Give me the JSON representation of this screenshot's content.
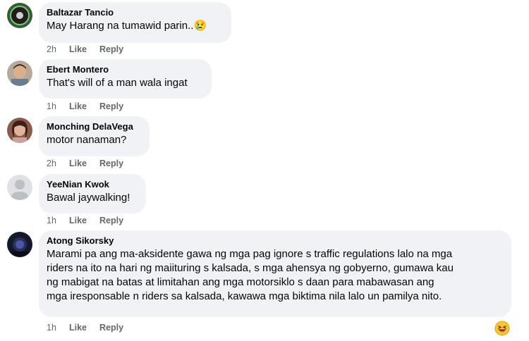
{
  "comments": [
    {
      "author": "Baltazar Tancio",
      "text": "May Harang na tumawid parin..",
      "emoji": "😢",
      "time": "2h",
      "like": "Like",
      "reply": "Reply"
    },
    {
      "author": "Ebert Montero",
      "text": "That's will of a man wala ingat",
      "time": "1h",
      "like": "Like",
      "reply": "Reply"
    },
    {
      "author": "Monching DelaVega",
      "text": "motor nanaman?",
      "time": "2h",
      "like": "Like",
      "reply": "Reply"
    },
    {
      "author": "YeeNian Kwok",
      "text": "Bawal jaywalking!",
      "time": "1h",
      "like": "Like",
      "reply": "Reply"
    },
    {
      "author": "Atong Sikorsky",
      "text_lines": [
        "Marami pa ang ma-aksidente gawa ng mga pag ignore s traffic regulations lalo na mga",
        "riders na ito na hari ng maiituring s kalsada, s mga ahensya ng gobyerno, gumawa kau",
        "ng mabigat na batas at limitahan ang mga motorsiklo s daan para mabawasan ang",
        "mga iresponsable n riders sa kalsada, kawawa mga biktima nila lalo un pamilya nito."
      ],
      "time": "1h",
      "like": "Like",
      "reply": "Reply"
    }
  ],
  "reaction_emoji": "😝",
  "colors": {
    "bubble": "#f0f2f5",
    "meta": "#65676b",
    "text": "#050505"
  }
}
